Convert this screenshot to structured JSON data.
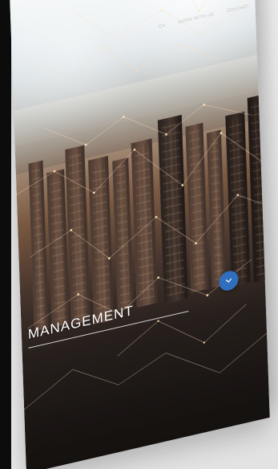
{
  "page": {
    "background_color": "#efefef",
    "left_bezel_color": "#0d0d0d"
  },
  "header": {
    "nav_items": [
      {
        "label": "CH"
      },
      {
        "label": "WORK WITH US"
      },
      {
        "label": "CONTACT"
      }
    ]
  },
  "hero": {
    "headline": "MANAGEMENT"
  },
  "badge": {
    "icon": "chevron-down-icon",
    "color": "#2f6fbe"
  }
}
